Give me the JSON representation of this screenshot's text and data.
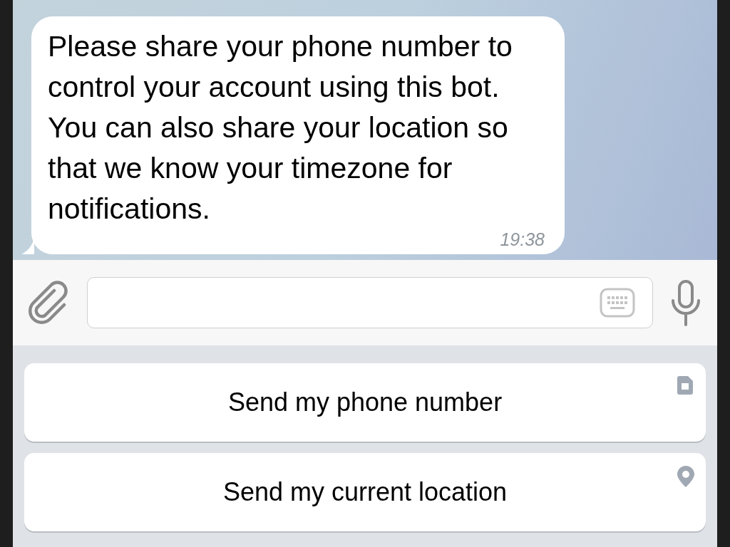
{
  "message": {
    "text": "Please share your phone number to control your account using this bot. You can also share your location so that we know your timezone for notifications.",
    "time": "19:38"
  },
  "keyboard_buttons": [
    {
      "label": "Send my phone number",
      "kind": "phone"
    },
    {
      "label": "Send my current location",
      "kind": "location"
    }
  ]
}
